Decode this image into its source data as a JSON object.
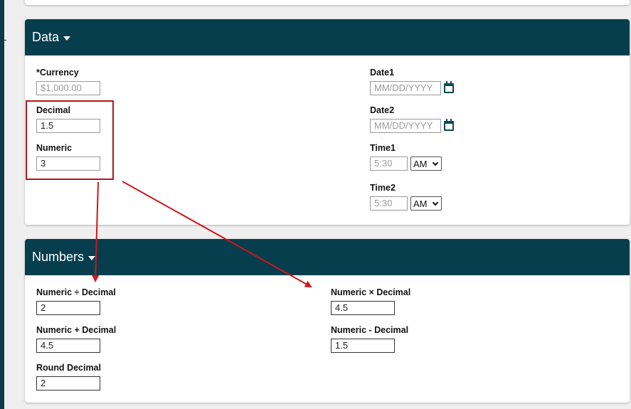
{
  "data_panel": {
    "title": "Data",
    "fields": {
      "currency": {
        "label": "*Currency",
        "placeholder": "$1,000.00",
        "value": ""
      },
      "decimal": {
        "label": "Decimal",
        "value": "1.5"
      },
      "numeric": {
        "label": "Numeric",
        "value": "3"
      },
      "date1": {
        "label": "Date1",
        "placeholder": "MM/DD/YYYY",
        "value": ""
      },
      "date2": {
        "label": "Date2",
        "placeholder": "MM/DD/YYYY",
        "value": ""
      },
      "time1": {
        "label": "Time1",
        "placeholder": "5:30",
        "value": "",
        "ampm": "AM"
      },
      "time2": {
        "label": "Time2",
        "placeholder": "5:30",
        "value": "",
        "ampm": "AM"
      }
    }
  },
  "numbers_panel": {
    "title": "Numbers",
    "fields": {
      "divide": {
        "label": "Numeric ÷ Decimal",
        "value": "2"
      },
      "plus": {
        "label": "Numeric + Decimal",
        "value": "4.5"
      },
      "round": {
        "label": "Round Decimal",
        "value": "2"
      },
      "multiply": {
        "label": "Numeric × Decimal",
        "value": "4.5"
      },
      "minus": {
        "label": "Numeric - Decimal",
        "value": "1.5"
      }
    }
  },
  "icons": {
    "calendar": "calendar-icon",
    "dropdown": "chevron-down-icon",
    "panel_toggle": "caret-down-icon"
  },
  "colors": {
    "header_bg": "#063e4e",
    "annotation_red": "#d0161c",
    "highlight_border": "#b3151b"
  }
}
